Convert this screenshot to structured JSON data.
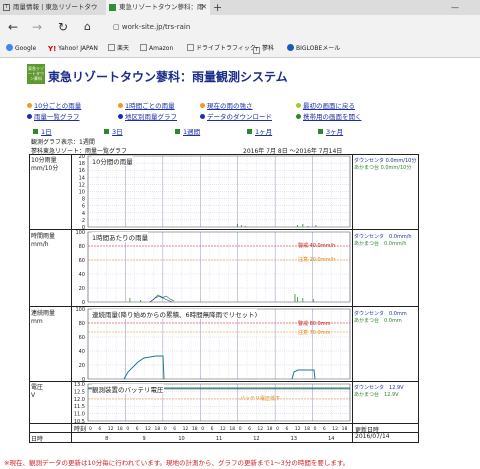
{
  "browser": {
    "tabs": [
      {
        "label": "雨量情報 | 東急リゾートタウ",
        "active": false
      },
      {
        "label": "東急リゾートタウン蓼科：雨",
        "active": true
      }
    ],
    "url": "work-site.jp/trs-rain",
    "bookmarks": [
      "Google",
      "Yahoo! JAPAN",
      "楽天",
      "Amazon",
      "ドライブトラフィック",
      "蓼科",
      "BIGLOBEメール"
    ]
  },
  "page": {
    "logo_text": "東急リゾートタウン蓼科",
    "title": "東急リゾートタウン蓼科：雨量観測システム",
    "menu": [
      {
        "label": "10分ごとの雨量",
        "color": "#f39a1e"
      },
      {
        "label": "1時間ごとの雨量",
        "color": "#f39a1e"
      },
      {
        "label": "現在の雨の強さ",
        "color": "#f39a1e"
      },
      {
        "label": "最初の画面に戻る",
        "color": "#9acd32"
      },
      {
        "label": "雨量一覧グラフ",
        "color": "#1b2fa8"
      },
      {
        "label": "地区別雨量グラフ",
        "color": "#1b2fa8"
      },
      {
        "label": "データのダウンロード",
        "color": "#1b2fa8"
      },
      {
        "label": "携帯用の画面を開く",
        "color": "#2a8a2a"
      }
    ],
    "periods": [
      "1日",
      "3日",
      "1週間",
      "1ヶ月",
      "3ヶ月"
    ],
    "graph_display": "観測グラフ表示：1週間",
    "graph_subtitle": "蓼科東急リゾート：雨量一覧グラフ",
    "date_range": "2016年 7月 8日 ～2016年 7月14日",
    "panels": [
      {
        "label": "10分雨量\nmm/10分",
        "title": "10分間の雨量",
        "yticks": [
          "20",
          "18",
          "16",
          "14",
          "12",
          "10",
          "8",
          "6",
          "4",
          "2",
          "0"
        ],
        "legend": [
          {
            "name": "ダウンセンタ",
            "value": "0.0mm/10分"
          },
          {
            "name": "あかまつ台",
            "value": "0.0mm/10分"
          }
        ]
      },
      {
        "label": "時間雨量\nmm/h",
        "title": "1時間あたりの雨量",
        "yticks": [
          "100",
          "80",
          "60",
          "40",
          "20",
          "0"
        ],
        "legend": [
          {
            "name": "ダウンセンタ",
            "value": "0.0mm/h"
          },
          {
            "name": "あかまつ台",
            "value": "0.0mm/h"
          }
        ],
        "thresholds": [
          {
            "label": "警戒",
            "value": "40.0mm/h"
          },
          {
            "name": "注意",
            "label": "注意",
            "value": "20.0mm/h"
          }
        ]
      },
      {
        "label": "連続雨量\nmm",
        "title": "連続雨量(降り始めからの累積、6時間無降雨でリセット)",
        "yticks": [
          "100",
          "80",
          "60",
          "40",
          "20",
          "0"
        ],
        "legend": [
          {
            "name": "ダウンセンタ",
            "value": "0.0mm"
          },
          {
            "name": "あかまつ台",
            "value": "0.0mm"
          }
        ],
        "thresholds": [
          {
            "label": "警戒",
            "value": "80.0mm"
          },
          {
            "label": "注意",
            "value": "70.0mm"
          }
        ]
      },
      {
        "label": "電圧\nV",
        "title": "観測装置のバッテリ電圧",
        "yticks": [
          "13.0",
          "12.5",
          "12.0",
          "11.5",
          "11.0",
          "10.5"
        ],
        "legend": [
          {
            "name": "ダウンセンタ",
            "value": "12.9V"
          },
          {
            "name": "あかまつ台",
            "value": "12.9V"
          }
        ],
        "thresholds": [
          {
            "label": "バッテリ電圧低下"
          }
        ]
      }
    ],
    "time_row": {
      "label": "時刻",
      "ticks": [
        "0",
        "6",
        "12",
        "18"
      ]
    },
    "date_row": {
      "label": "日時",
      "days": [
        "8",
        "9",
        "10",
        "11",
        "12",
        "13",
        "14"
      ]
    },
    "update_label": "更新日時",
    "update_value": "2016/07/14",
    "footer_note": "※現在、観測データの更新は10分毎に行われています。現地の計測から、グラフの更新まで1～3分の時間を要します。"
  }
}
